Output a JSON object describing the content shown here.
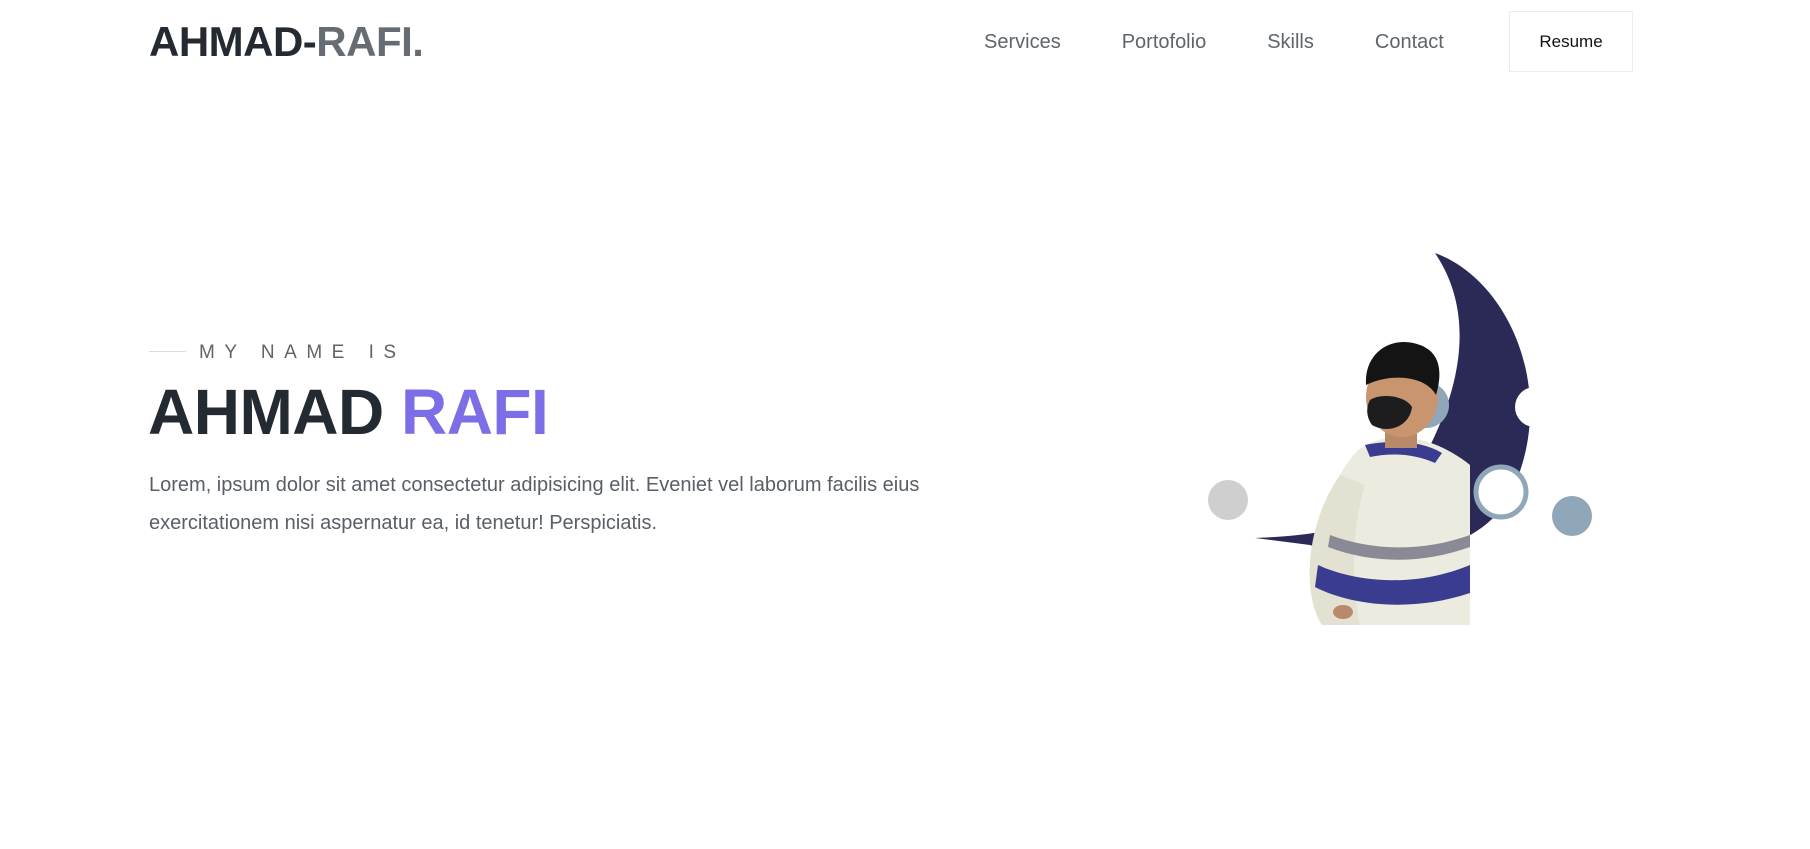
{
  "nav": {
    "logo_first": "AHMAD-",
    "logo_second": "RAFI.",
    "links": [
      "Services",
      "Portofolio",
      "Skills",
      "Contact"
    ],
    "resume_label": "Resume"
  },
  "hero": {
    "intro": "MY NAME IS",
    "name_first": "AHMAD",
    "name_second": "RAFI",
    "description": "Lorem, ipsum dolor sit amet consectetur adipisicing elit. Eveniet vel laborum facilis eius exercitationem nisi aspernatur ea, id tenetur! Perspiciatis."
  },
  "colors": {
    "text_dark": "#232a31",
    "logo_muted": "#666c73",
    "accent_purple": "#7b6ee6",
    "moon_navy": "#2b2a56",
    "bubble_blue": "#8fa7b9",
    "bubble_gray": "#cfcfcf"
  },
  "illustration": {
    "icon": "portrait-with-moon-illustration"
  }
}
